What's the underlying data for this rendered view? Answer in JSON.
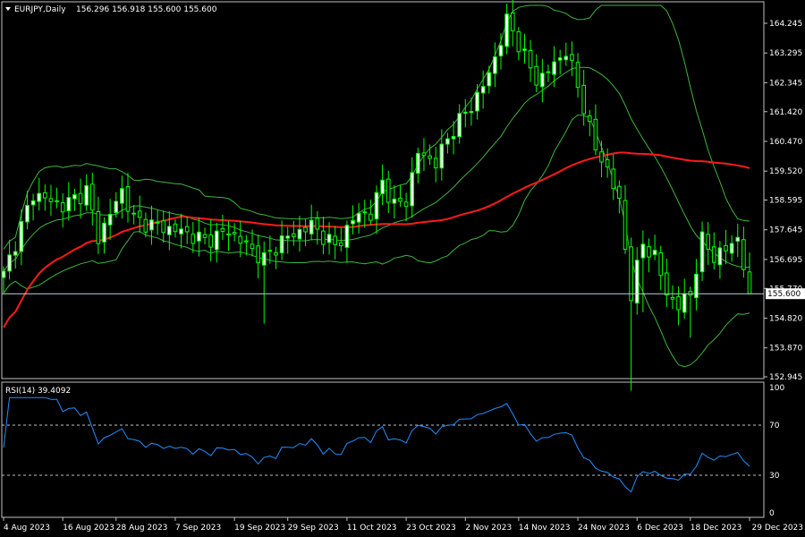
{
  "header": {
    "symbol_label": "EURJPY,Daily",
    "ohlc": "156.296 156.918 155.600 155.600"
  },
  "colors": {
    "background": "#000000",
    "axis": "#c0c0c0",
    "candle": "#00ff00",
    "bull_fill": "#ffffff",
    "bear_fill": "#000000",
    "bands": "#3cb53c",
    "ma": "#ff1a1a",
    "rsi": "#1e90ff",
    "price_line": "#c0d0e0"
  },
  "chart_data": [
    {
      "type": "candlestick",
      "symbol": "EURJPY",
      "timeframe": "Daily",
      "y_ticks": [
        "164.245",
        "163.295",
        "162.345",
        "161.420",
        "160.470",
        "159.520",
        "158.595",
        "157.645",
        "156.695",
        "155.770",
        "154.820",
        "153.870",
        "152.945"
      ],
      "ylim": [
        152.945,
        164.245
      ],
      "x_ticks": [
        "4 Aug 2023",
        "16 Aug 2023",
        "28 Aug 2023",
        "7 Sep 2023",
        "19 Sep 2023",
        "29 Sep 2023",
        "11 Oct 2023",
        "23 Oct 2023",
        "2 Nov 2023",
        "14 Nov 2023",
        "24 Nov 2023",
        "6 Dec 2023",
        "18 Dec 2023",
        "29 Dec 2023"
      ],
      "current_price": "155.600",
      "price_waypoints": [
        [
          0,
          156.2
        ],
        [
          5,
          158.8
        ],
        [
          10,
          158.4
        ],
        [
          14,
          158.9
        ],
        [
          16,
          157.4
        ],
        [
          20,
          158.9
        ],
        [
          22,
          158.0
        ],
        [
          25,
          157.8
        ],
        [
          30,
          157.6
        ],
        [
          34,
          157.3
        ],
        [
          38,
          157.6
        ],
        [
          40,
          157.3
        ],
        [
          44,
          156.7
        ],
        [
          47,
          157.3
        ],
        [
          52,
          157.8
        ],
        [
          56,
          157.1
        ],
        [
          60,
          158.2
        ],
        [
          62,
          158.1
        ],
        [
          64,
          159.2
        ],
        [
          66,
          158.4
        ],
        [
          68,
          158.6
        ],
        [
          70,
          160.1
        ],
        [
          73,
          159.8
        ],
        [
          76,
          160.9
        ],
        [
          79,
          161.6
        ],
        [
          82,
          162.6
        ],
        [
          85,
          164.3
        ],
        [
          86,
          164.0
        ],
        [
          88,
          163.2
        ],
        [
          90,
          162.4
        ],
        [
          93,
          162.9
        ],
        [
          95,
          163.4
        ],
        [
          98,
          161.6
        ],
        [
          100,
          160.2
        ],
        [
          102,
          159.6
        ],
        [
          104,
          158.5
        ],
        [
          106,
          155.6
        ],
        [
          108,
          157.2
        ],
        [
          110,
          156.8
        ],
        [
          112,
          155.6
        ],
        [
          114,
          155.2
        ],
        [
          116,
          155.6
        ],
        [
          118,
          157.3
        ],
        [
          120,
          156.8
        ],
        [
          122,
          157.0
        ],
        [
          124,
          157.4
        ],
        [
          126,
          155.6
        ]
      ],
      "indicators": [
        "Bollinger Bands",
        "Moving Average"
      ]
    },
    {
      "type": "line",
      "name": "RSI(14)",
      "label": "RSI(14) 39.4092",
      "ylim": [
        0,
        100
      ],
      "y_ticks": [
        "100",
        "70",
        "30",
        "0"
      ],
      "levels": [
        70,
        30
      ]
    }
  ]
}
